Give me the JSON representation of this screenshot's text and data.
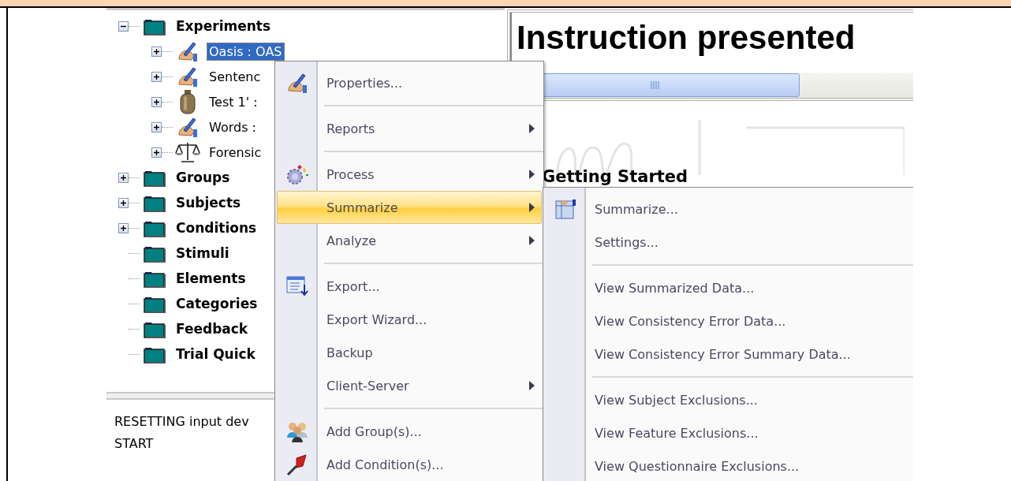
{
  "tree": {
    "items": [
      {
        "label": "Experiments",
        "kind": "folder",
        "expanded": true,
        "selected": false,
        "children": [
          {
            "label": "Oasis : OAS",
            "kind": "experiment",
            "expanded": false,
            "selected": true
          },
          {
            "label": "Sentenc",
            "kind": "experiment",
            "expanded": false,
            "selected": false
          },
          {
            "label": "Test 1' :",
            "kind": "test",
            "expanded": false,
            "selected": false
          },
          {
            "label": "Words :",
            "kind": "experiment",
            "expanded": false,
            "selected": false
          },
          {
            "label": "Forensic",
            "kind": "forensic",
            "expanded": false,
            "selected": false
          }
        ]
      },
      {
        "label": "Groups",
        "kind": "folder",
        "expanded": false,
        "selected": false
      },
      {
        "label": "Subjects",
        "kind": "folder",
        "expanded": false,
        "selected": false
      },
      {
        "label": "Conditions",
        "kind": "folder",
        "expanded": false,
        "selected": false
      },
      {
        "label": "Stimuli",
        "kind": "folder",
        "selected": false
      },
      {
        "label": "Elements",
        "kind": "folder",
        "selected": false
      },
      {
        "label": "Categories",
        "kind": "folder",
        "selected": false
      },
      {
        "label": "Feedback",
        "kind": "folder",
        "selected": false
      },
      {
        "label": "Trial Quick",
        "kind": "folder",
        "selected": false
      }
    ]
  },
  "log": {
    "lines": [
      "RESETTING input dev",
      "START"
    ]
  },
  "viewer": {
    "title": "Instruction presented",
    "heading": "Getting Started"
  },
  "context_menu": {
    "items": [
      {
        "kind": "item",
        "label": "Properties...",
        "submenu": false,
        "selected": false
      },
      {
        "kind": "separator"
      },
      {
        "kind": "item",
        "label": "Reports",
        "submenu": true,
        "selected": false
      },
      {
        "kind": "separator"
      },
      {
        "kind": "item",
        "label": "Process",
        "submenu": true,
        "selected": false
      },
      {
        "kind": "item",
        "label": "Summarize",
        "submenu": true,
        "selected": true
      },
      {
        "kind": "item",
        "label": "Analyze",
        "submenu": true,
        "selected": false
      },
      {
        "kind": "separator"
      },
      {
        "kind": "item",
        "label": "Export...",
        "submenu": false,
        "selected": false
      },
      {
        "kind": "item",
        "label": "Export Wizard...",
        "submenu": false,
        "selected": false
      },
      {
        "kind": "item",
        "label": "Backup",
        "submenu": false,
        "selected": false
      },
      {
        "kind": "item",
        "label": "Client-Server",
        "submenu": true,
        "selected": false
      },
      {
        "kind": "separator"
      },
      {
        "kind": "item",
        "label": "Add Group(s)...",
        "submenu": false,
        "selected": false
      },
      {
        "kind": "item",
        "label": "Add Condition(s)...",
        "submenu": false,
        "selected": false
      }
    ]
  },
  "submenu": {
    "items": [
      {
        "kind": "item",
        "label": "Summarize...",
        "selected": false
      },
      {
        "kind": "item",
        "label": "Settings...",
        "selected": false
      },
      {
        "kind": "separator"
      },
      {
        "kind": "item",
        "label": "View Summarized Data...",
        "selected": false
      },
      {
        "kind": "item",
        "label": "View Consistency Error Data...",
        "selected": false
      },
      {
        "kind": "item",
        "label": "View Consistency Error Summary Data...",
        "selected": false
      },
      {
        "kind": "separator"
      },
      {
        "kind": "item",
        "label": "View Subject Exclusions...",
        "selected": false
      },
      {
        "kind": "item",
        "label": "View Feature Exclusions...",
        "selected": false
      },
      {
        "kind": "item",
        "label": "View Questionnaire Exclusions...",
        "selected": false
      }
    ]
  }
}
